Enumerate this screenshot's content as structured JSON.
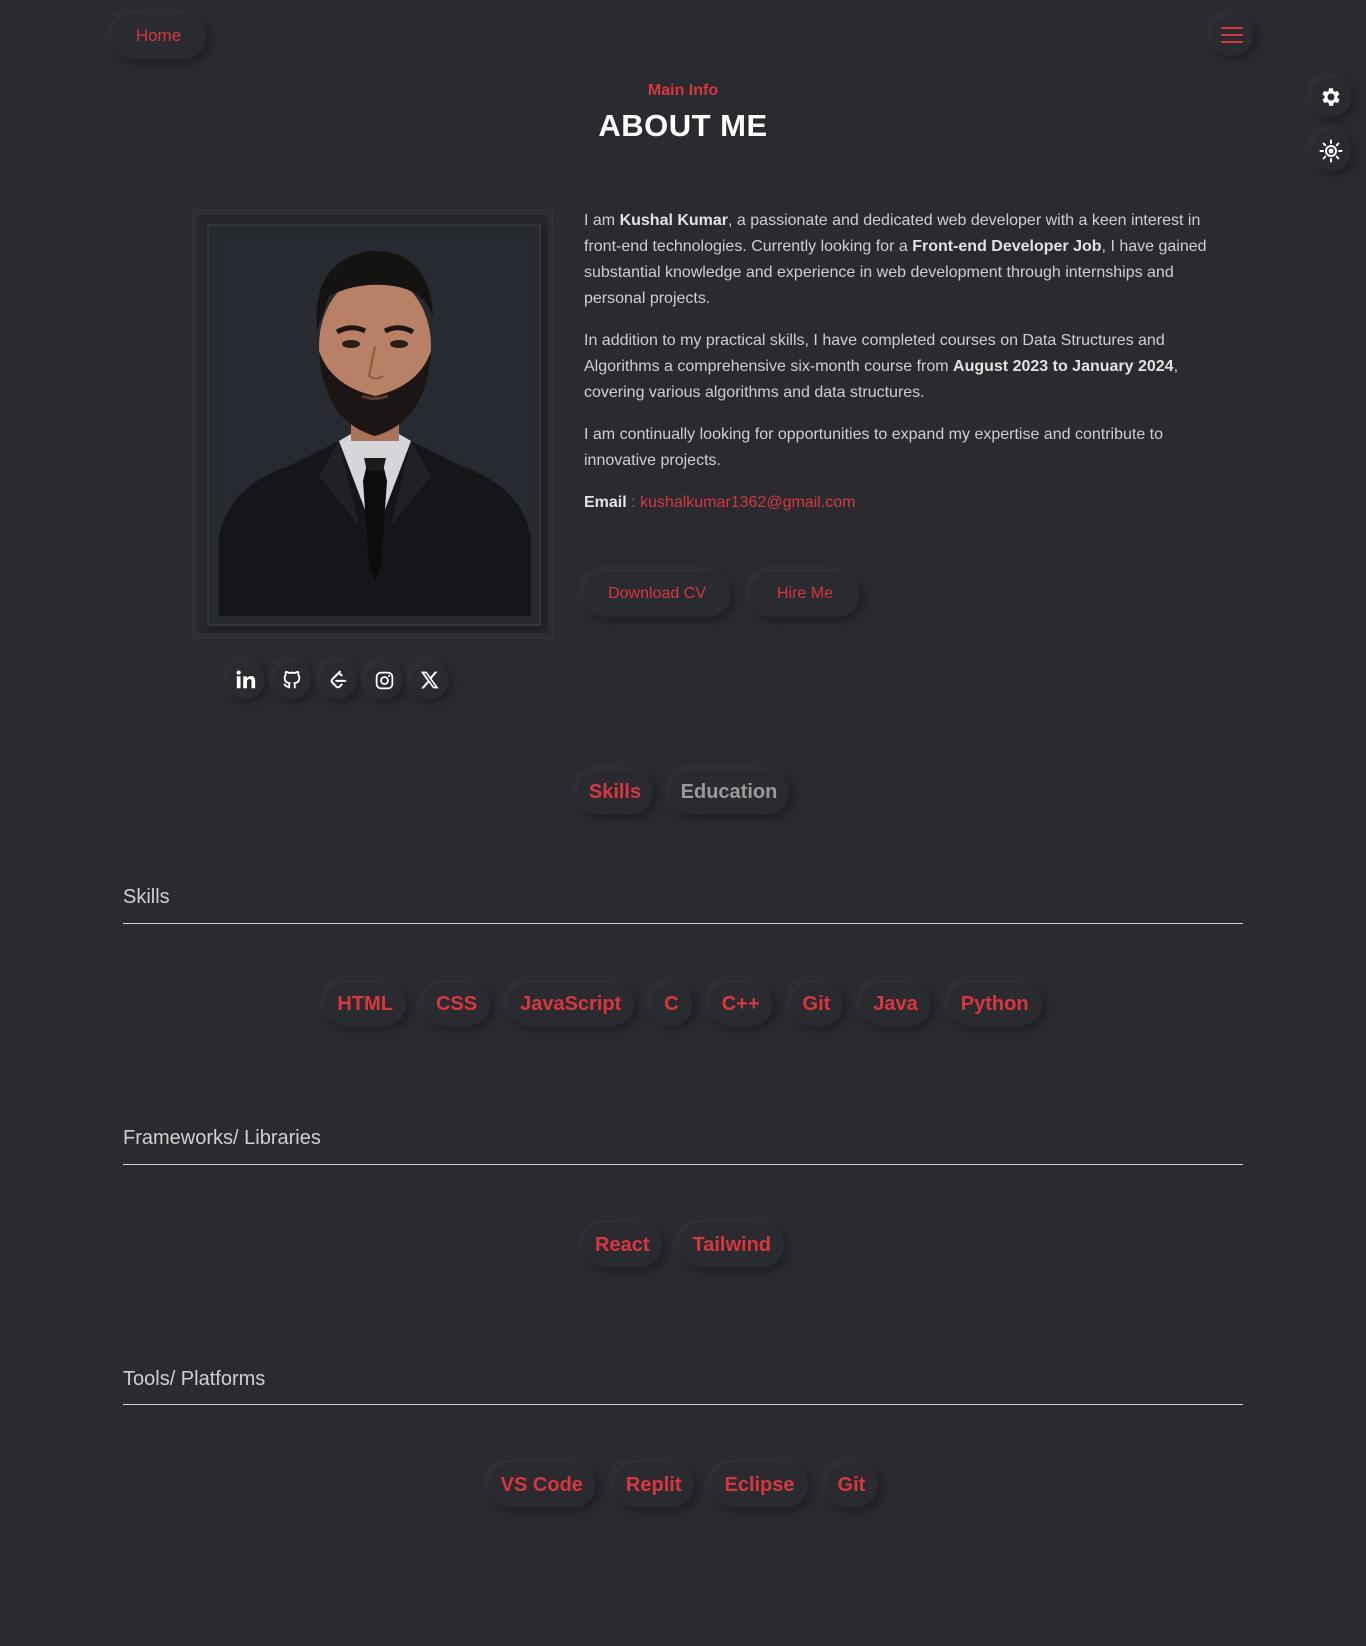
{
  "header": {
    "home_label": "Home",
    "menu_icon": "hamburger-icon",
    "settings_icon": "gear-icon",
    "theme_icon": "sun-icon"
  },
  "hero": {
    "eyebrow": "Main Info",
    "title": "ABOUT ME"
  },
  "profile": {
    "photo_alt": "Kushal Kumar portrait",
    "socials": [
      {
        "name": "linkedin-icon",
        "glyph": "in"
      },
      {
        "name": "github-icon",
        "glyph": ""
      },
      {
        "name": "leetcode-icon",
        "glyph": ""
      },
      {
        "name": "instagram-icon",
        "glyph": ""
      },
      {
        "name": "x-twitter-icon",
        "glyph": "X"
      }
    ]
  },
  "about": {
    "p1_pre": "I am ",
    "p1_name": "Kushal Kumar",
    "p1_mid": ", a passionate and dedicated web developer with a keen interest in front-end technologies. Currently looking for a ",
    "p1_job": "Front-end Developer Job",
    "p1_post": ", I have gained substantial knowledge and experience in web development through internships and personal projects.",
    "p2_pre": "In addition to my practical skills, I have completed courses on Data Structures and Algorithms a comprehensive six-month course from ",
    "p2_bold": "August 2023 to January 2024",
    "p2_post": ", covering various algorithms and data structures.",
    "p3": "I am continually looking for opportunities to expand my expertise and contribute to innovative projects.",
    "email_label": "Email",
    "email_sep": " : ",
    "email": "kushalkumar1362@gmail.com"
  },
  "actions": {
    "download_cv": "Download CV",
    "hire_me": "Hire Me"
  },
  "tabs": [
    {
      "label": "Skills",
      "active": true
    },
    {
      "label": "Education",
      "active": false
    }
  ],
  "sections": {
    "skills": {
      "title": "Skills",
      "items": [
        "HTML",
        "CSS",
        "JavaScript",
        "C",
        "C++",
        "Git",
        "Java",
        "Python"
      ]
    },
    "frameworks": {
      "title": "Frameworks/ Libraries",
      "items": [
        "React",
        "Tailwind"
      ]
    },
    "tools": {
      "title": "Tools/ Platforms",
      "items": [
        "VS Code",
        "Replit",
        "Eclipse",
        "Git"
      ]
    }
  },
  "colors": {
    "background": "#2a2b30",
    "accent": "#d9363e",
    "text": "#cfcfcf"
  }
}
